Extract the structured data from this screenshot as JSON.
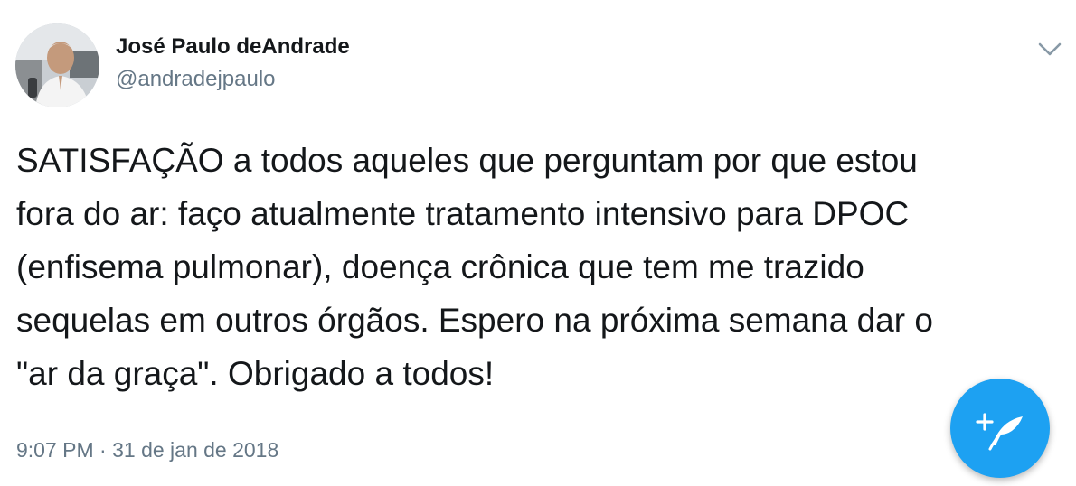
{
  "author": {
    "display_name": "José Paulo deAndrade",
    "handle": "@andradejpaulo"
  },
  "tweet": {
    "text_lines": [
      "SATISFAÇÃO a todos aqueles que perguntam por que estou",
      "fora do ar: faço atualmente tratamento intensivo para DPOC",
      "(enfisema pulmonar), doença crônica que tem me trazido",
      "sequelas em outros órgãos. Espero na próxima semana dar o",
      "\"ar da graça\". Obrigado a todos!"
    ],
    "timestamp": "9:07 PM · 31 de jan de 2018"
  },
  "icons": {
    "menu": "chevron-down-icon",
    "compose": "compose-tweet-icon"
  },
  "colors": {
    "text": "#14171a",
    "secondary_text": "#657786",
    "accent": "#1da1f2",
    "background": "#ffffff"
  }
}
